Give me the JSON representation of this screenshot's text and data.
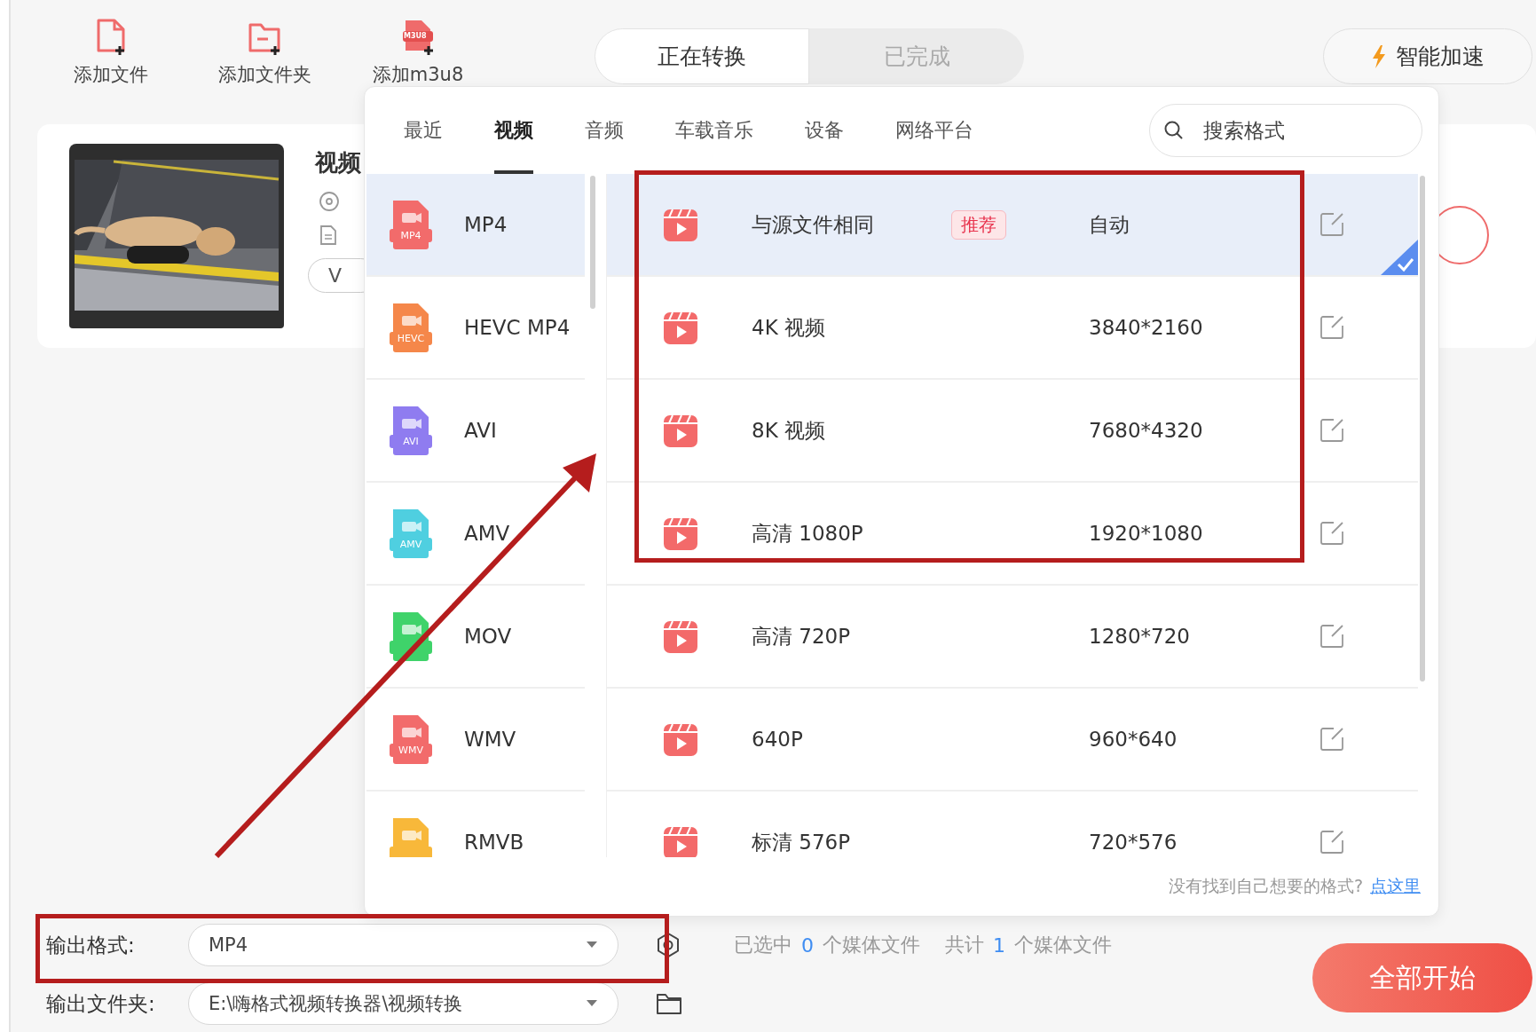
{
  "toolbar": [
    {
      "label": "添加文件",
      "kind": "file"
    },
    {
      "label": "添加文件夹",
      "kind": "folder"
    },
    {
      "label": "添加m3u8",
      "kind": "m3u8",
      "icon_text": "M3U8"
    }
  ],
  "view_tabs": [
    {
      "label": "正在转换",
      "selected": true
    },
    {
      "label": "已完成",
      "selected": false
    }
  ],
  "speed_button": {
    "label": "智能加速"
  },
  "file_card": {
    "title": "视频",
    "chip": "V"
  },
  "format_popup": {
    "tabs": [
      {
        "label": "最近",
        "selected": false
      },
      {
        "label": "视频",
        "selected": true
      },
      {
        "label": "音频",
        "selected": false
      },
      {
        "label": "车载音乐",
        "selected": false
      },
      {
        "label": "设备",
        "selected": false
      },
      {
        "label": "网络平台",
        "selected": false
      }
    ],
    "search": {
      "placeholder": "搜索格式"
    },
    "formats": [
      {
        "name": "MP4",
        "icon_text": "MP4",
        "color": "#f26b6b",
        "selected": true
      },
      {
        "name": "HEVC MP4",
        "icon_text": "HEVC",
        "color": "#f5874a",
        "selected": false
      },
      {
        "name": "AVI",
        "icon_text": "AVI",
        "color": "#8f7cf0",
        "selected": false
      },
      {
        "name": "AMV",
        "icon_text": "AMV",
        "color": "#4fcfe0",
        "selected": false
      },
      {
        "name": "MOV",
        "color": "#3fd36a",
        "selected": false
      },
      {
        "name": "WMV",
        "icon_text": "WMV",
        "color": "#f26b6b",
        "selected": false
      },
      {
        "name": "RMVB",
        "color": "#f8b83a",
        "selected": false
      }
    ],
    "presets": [
      {
        "name": "与源文件相同",
        "badge": "推荐",
        "resolution": "自动",
        "selected": true
      },
      {
        "name": "4K 视频",
        "resolution": "3840*2160",
        "selected": false
      },
      {
        "name": "8K 视频",
        "resolution": "7680*4320",
        "selected": false
      },
      {
        "name": "高清 1080P",
        "resolution": "1920*1080",
        "selected": false
      },
      {
        "name": "高清 720P",
        "resolution": "1280*720",
        "selected": false
      },
      {
        "name": "640P",
        "resolution": "960*640",
        "selected": false
      },
      {
        "name": "标清 576P",
        "resolution": "720*576",
        "selected": false
      }
    ],
    "hint": "没有找到自己想要的格式?",
    "hint_link": "点这里"
  },
  "output_format": {
    "label": "输出格式:",
    "value": "MP4"
  },
  "output_folder": {
    "label": "输出文件夹:",
    "value": "E:\\嗨格式视频转换器\\视频转换"
  },
  "stats": [
    {
      "label": "已选中",
      "count": "0",
      "unit": "个媒体文件"
    },
    {
      "label": "共计",
      "count": "1",
      "unit": "个媒体文件"
    }
  ],
  "start_button": {
    "label": "全部开始"
  },
  "annotations": [
    {
      "kind": "box"
    },
    {
      "kind": "box"
    },
    {
      "kind": "arrow"
    }
  ]
}
